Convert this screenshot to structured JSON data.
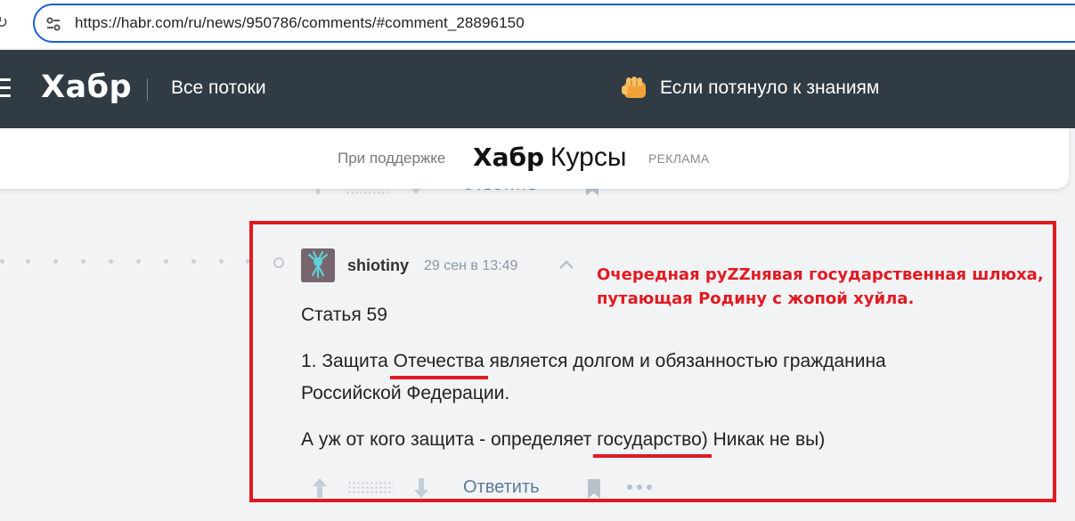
{
  "browser": {
    "url": "https://habr.com/ru/news/950786/comments/#comment_28896150",
    "reload_icon": "reload-icon",
    "site_info_icon": "tune-icon"
  },
  "header": {
    "logo": "Хабр",
    "nav_label": "Все потоки",
    "promo_text": "Если потянуло к знаниям",
    "promo_icon": "fist-icon",
    "bg_color": "#303b44"
  },
  "sponsor": {
    "support_label": "При поддержке",
    "brand_bold": "Хабр",
    "brand_light": "Курсы",
    "ad_label": "РЕКЛАМА"
  },
  "ghost_actions": {
    "reply_label": "Ответить"
  },
  "comment": {
    "author": "shiotiny",
    "time": "29 сен в 13:49",
    "annotation_line1": "Очередная руZZнявая государственная шлюха,",
    "annotation_line2": "путающая Родину с жопой хуйла.",
    "annotation_color": "#e01a22",
    "body": {
      "p1": "Статья 59",
      "p2_pre": "1. Защита ",
      "p2_hl": "Отечества",
      "p2_post": " является долгом и обязанностью гражданина Российской Федерации.",
      "p3_pre": "А уж от кого защита - определяет ",
      "p3_hl": "государство)",
      "p3_post": " Никак не вы)"
    },
    "actions": {
      "reply_label": "Ответить"
    }
  }
}
